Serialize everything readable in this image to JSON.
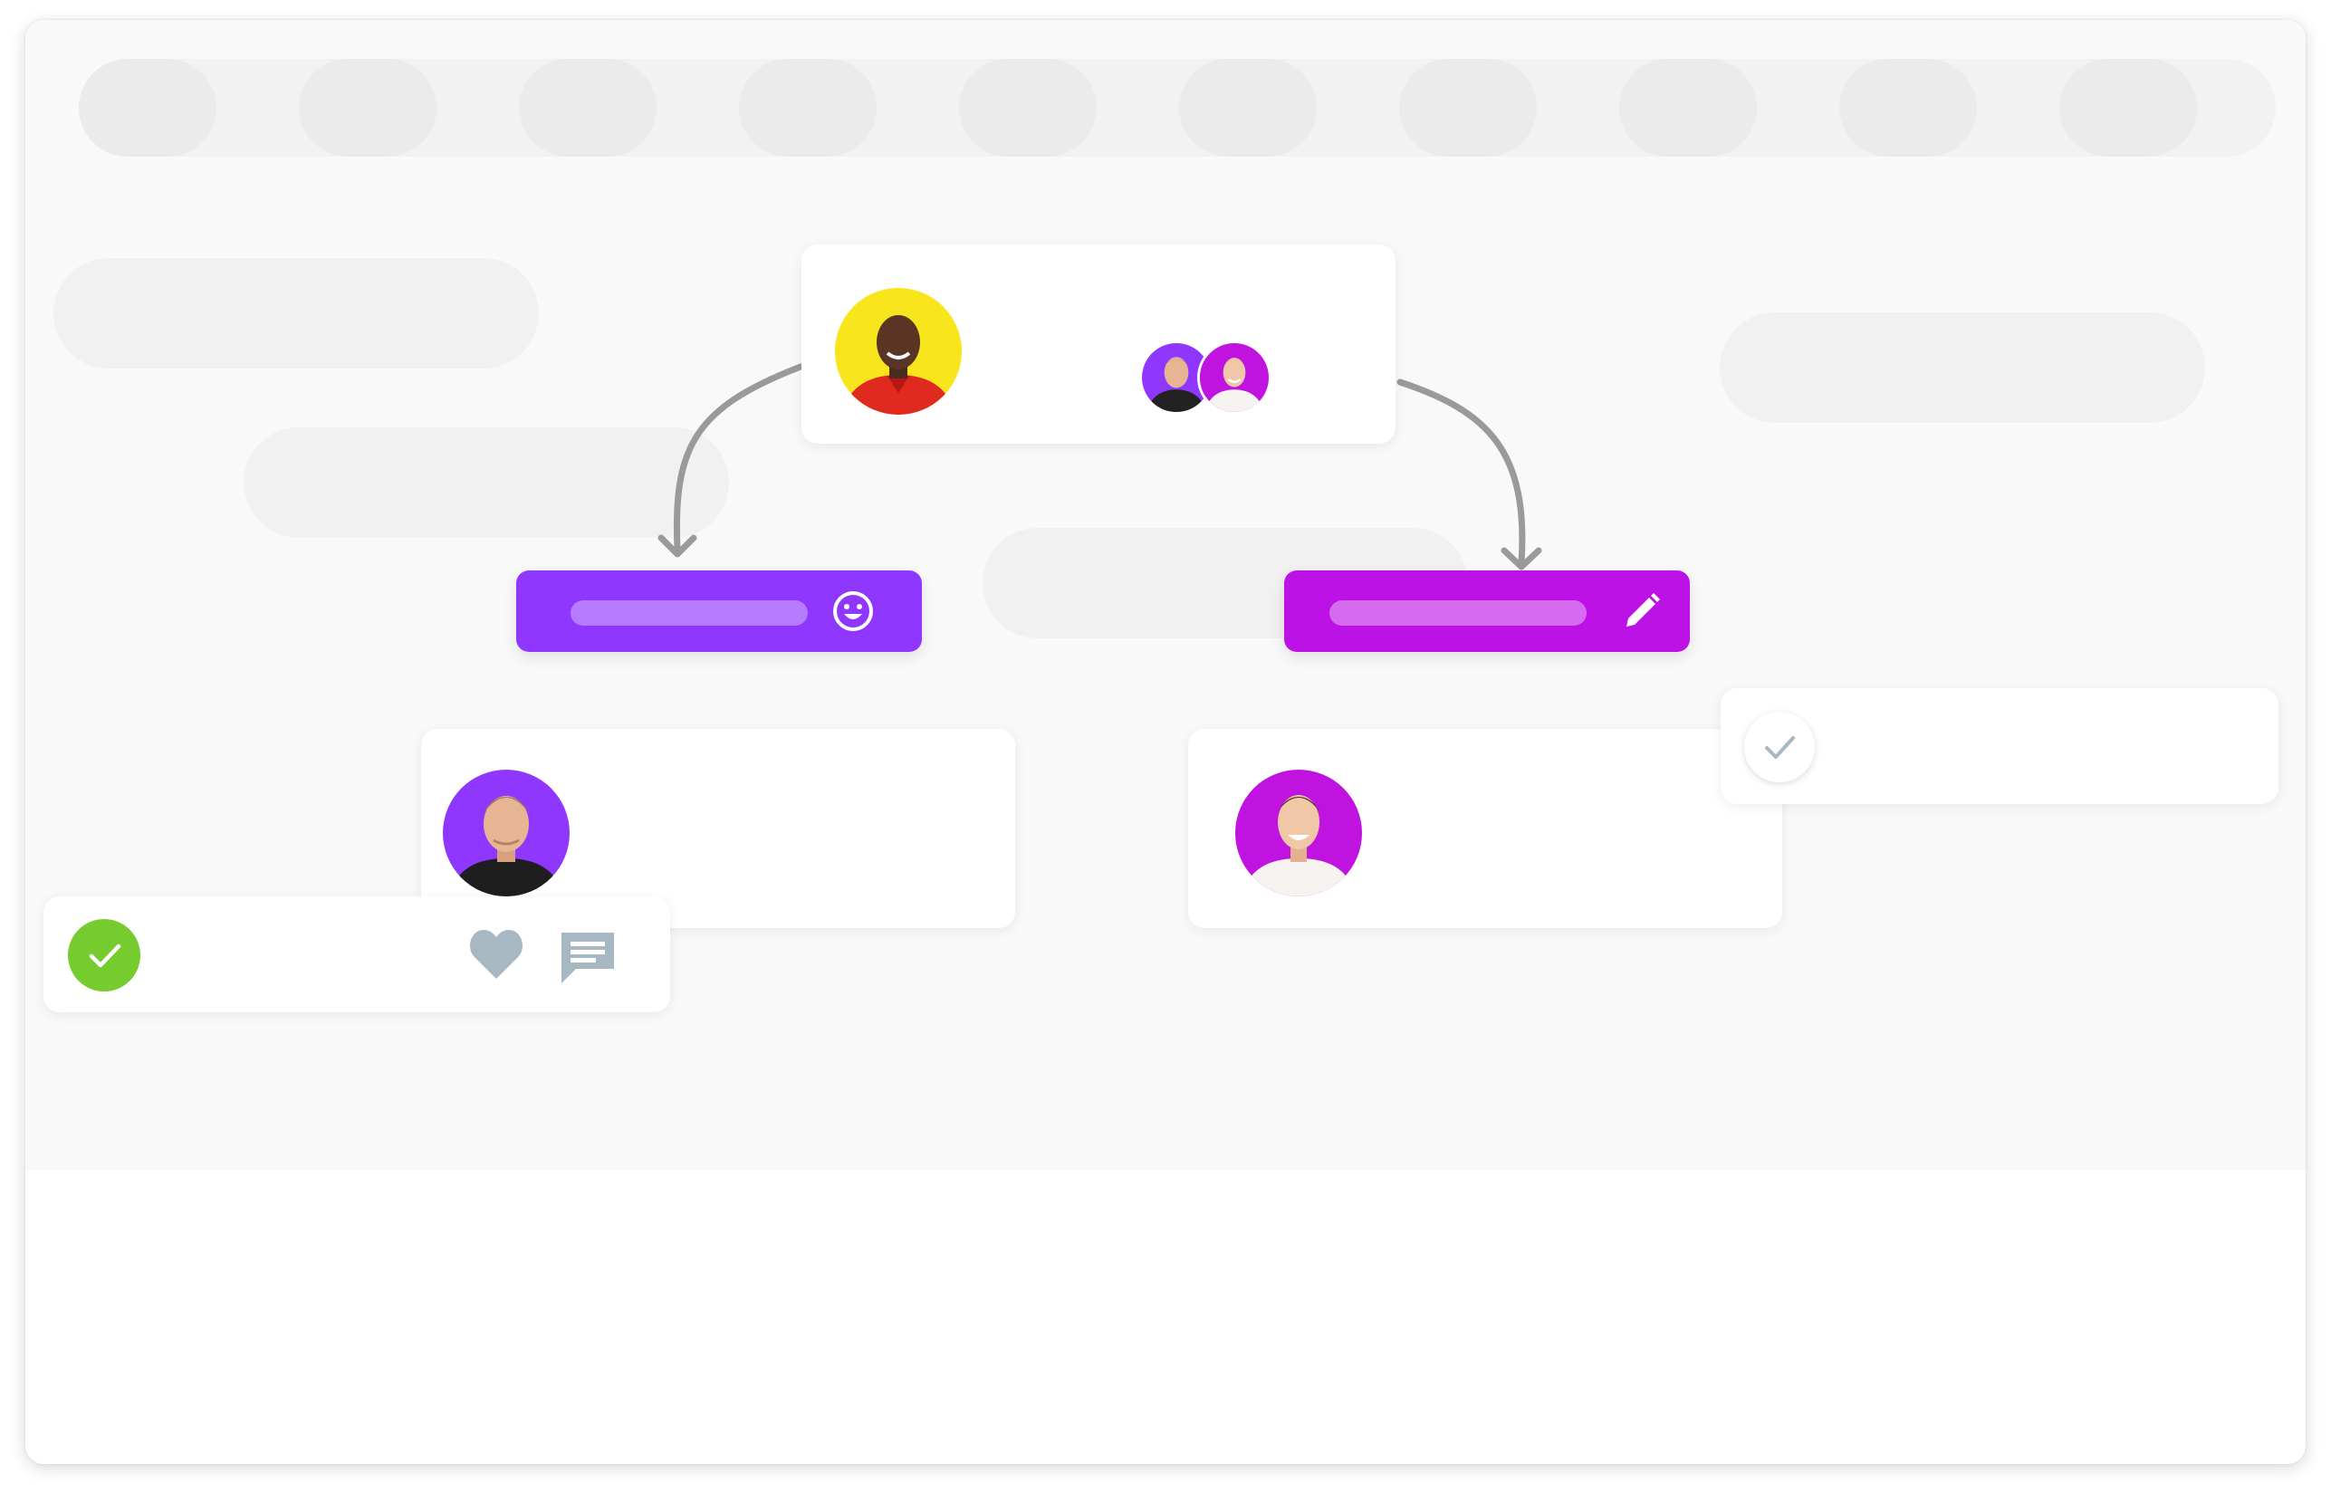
{
  "colors": {
    "canvas": "#f9f9f9",
    "placeholder": "#f1f1f1",
    "violet": "#8f37ff",
    "magenta": "#bc12e6",
    "green_check": "#76cc2e",
    "icon_gray": "#a7b8c2",
    "arrow_gray": "#9a9a9a",
    "avatar_yellow": "#f9e51c",
    "avatar_purple": "#8f37ff",
    "avatar_magenta": "#c113df"
  },
  "icons": {
    "smiley": "smiley-icon",
    "pencil": "pencil-icon",
    "check": "check-icon",
    "heart": "heart-icon",
    "comment": "comment-icon",
    "arrow": "arrow-down-icon"
  }
}
